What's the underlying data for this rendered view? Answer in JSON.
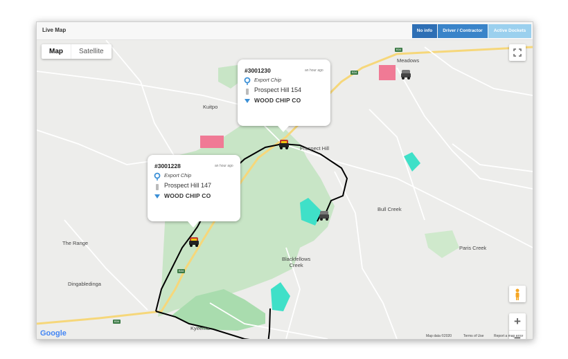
{
  "header": {
    "title": "Live Map",
    "buttons": {
      "no_info": "No info",
      "driver_contractor": "Driver / Contractor",
      "active_dockets": "Active Dockets"
    }
  },
  "map": {
    "toggle": {
      "map": "Map",
      "satellite": "Satellite"
    },
    "places": {
      "meadows": "Meadows",
      "kuitpo": "Kuitpo",
      "prospect_hill": "Prospect Hill",
      "bull_creek": "Bull Creek",
      "the_range": "The Range",
      "paris_creek": "Paris Creek",
      "blackfellows_creek": "Blackfellows\nCreek",
      "dingabledinga": "Dingabledinga",
      "kyeema": "Kyeema"
    },
    "road_badges": {
      "b34_top": "B34",
      "b34_mid": "B34",
      "b34_left": "B34",
      "b34_route": "B34"
    },
    "zoom": {
      "in": "+",
      "out": "−"
    },
    "attribution": {
      "google": "Google",
      "map_data": "Map data ©2020",
      "terms": "Terms of Use",
      "report": "Report a map error"
    }
  },
  "dockets": [
    {
      "id": "#3001230",
      "time": "an hour ago",
      "product": "Export Chip",
      "location": "Prospect Hill 154",
      "company": "WOOD CHIP CO"
    },
    {
      "id": "#3001228",
      "time": "an hour ago",
      "product": "Export Chip",
      "location": "Prospect Hill 147",
      "company": "WOOD CHIP CO"
    }
  ],
  "colors": {
    "blue_dark": "#2e6fb5",
    "blue_mid": "#3a84c9",
    "blue_light": "#9bd0ee",
    "forest": "#c8e5c6",
    "forest_dark": "#a9dcae",
    "road_yellow": "#f6d77a",
    "geofence_pink": "#f07a95",
    "geofence_teal": "#3fe0c8",
    "route": "#000000",
    "pin": "#3a8fd6"
  }
}
